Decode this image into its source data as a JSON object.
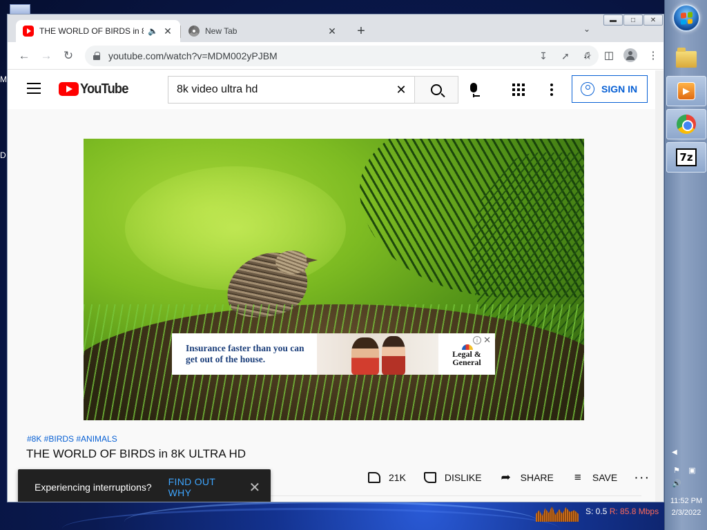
{
  "browser": {
    "tabs": [
      {
        "title": "THE WORLD OF BIRDS in 8K ULTRA HD - YouTube",
        "active": true,
        "audio": true
      },
      {
        "title": "New Tab",
        "active": false
      }
    ],
    "url": "youtube.com/watch?v=MDM002yPJBM"
  },
  "youtube": {
    "logo_text": "YouTube",
    "search_value": "8k video ultra hd",
    "sign_in_label": "SIGN IN",
    "video": {
      "hashtags": "#8K #BIRDS #ANIMALS",
      "title": "THE WORLD OF BIRDS in 8K ULTRA HD"
    },
    "ad": {
      "headline": "Insurance faster than you can get out of the house.",
      "brand": "Legal & General"
    },
    "actions": {
      "like_count": "21K",
      "dislike_label": "DISLIKE",
      "share_label": "SHARE",
      "save_label": "SAVE"
    },
    "toast": {
      "message": "Experiencing interruptions?",
      "action": "FIND OUT WHY"
    }
  },
  "taskbar": {
    "time": "11:52 PM",
    "date": "2/3/2022",
    "icons": [
      "start-orb",
      "folder-icon",
      "media-player-icon",
      "chrome-icon",
      "7zip-icon"
    ],
    "sevenzip_label": "7z"
  },
  "netmeter": {
    "s_label": "S: 0.5",
    "r_label": "R: 85.8 Mbps"
  },
  "colors": {
    "youtube_red": "#ff0000",
    "link_blue": "#065fd4",
    "toast_bg": "#212121",
    "toast_action": "#3ea6ff"
  }
}
